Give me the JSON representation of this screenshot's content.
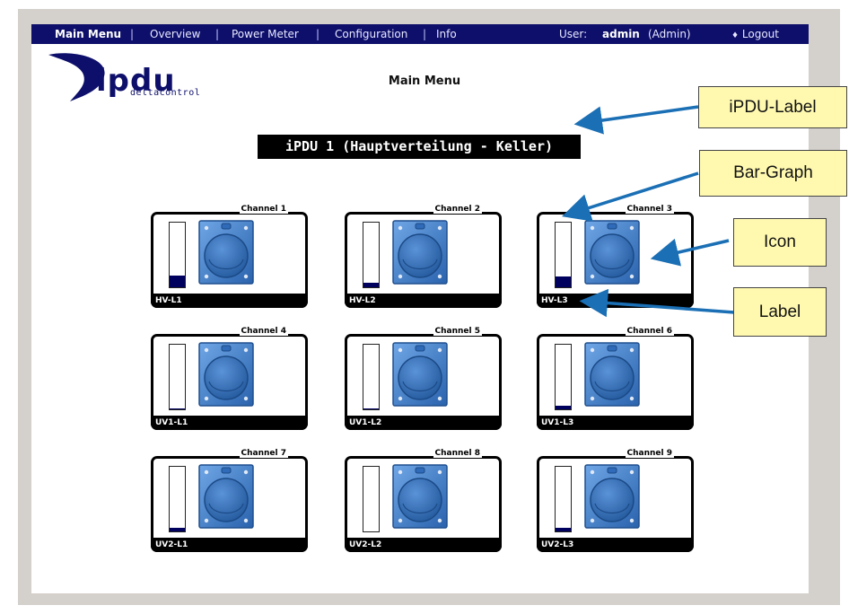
{
  "nav": {
    "items": [
      {
        "label": "Main Menu"
      },
      {
        "label": "Overview"
      },
      {
        "label": "Power Meter"
      },
      {
        "label": "Configuration"
      },
      {
        "label": "Info"
      }
    ],
    "separator": "|",
    "user_label": "User:",
    "user_name": "admin",
    "user_role": "(Admin)",
    "logout_label": "Logout"
  },
  "logo": {
    "main": "ipdu",
    "sub": "deltacontrol"
  },
  "page_title": "Main Menu",
  "ipdu_label": "iPDU 1 (Hauptverteilung - Keller)",
  "channels": [
    {
      "title": "Channel 1",
      "label": "HV-L1",
      "level": 0.18
    },
    {
      "title": "Channel 2",
      "label": "HV-L2",
      "level": 0.07
    },
    {
      "title": "Channel 3",
      "label": "HV-L3",
      "level": 0.17
    },
    {
      "title": "Channel 4",
      "label": "UV1-L1",
      "level": 0.02
    },
    {
      "title": "Channel 5",
      "label": "UV1-L2",
      "level": 0.02
    },
    {
      "title": "Channel 6",
      "label": "UV1-L3",
      "level": 0.05
    },
    {
      "title": "Channel 7",
      "label": "UV2-L1",
      "level": 0.06
    },
    {
      "title": "Channel 8",
      "label": "UV2-L2",
      "level": 0.0
    },
    {
      "title": "Channel 9",
      "label": "UV2-L3",
      "level": 0.05
    }
  ],
  "callouts": [
    {
      "label": "iPDU-Label"
    },
    {
      "label": "Bar-Graph"
    },
    {
      "label": "Icon"
    },
    {
      "label": "Label"
    }
  ],
  "colors": {
    "nav_bg": "#0d0f6b",
    "bar_fill": "#00005e",
    "callout_bg": "#fff9b0",
    "arrow": "#1a6fb5",
    "socket_blue": "#3a7cc8"
  }
}
